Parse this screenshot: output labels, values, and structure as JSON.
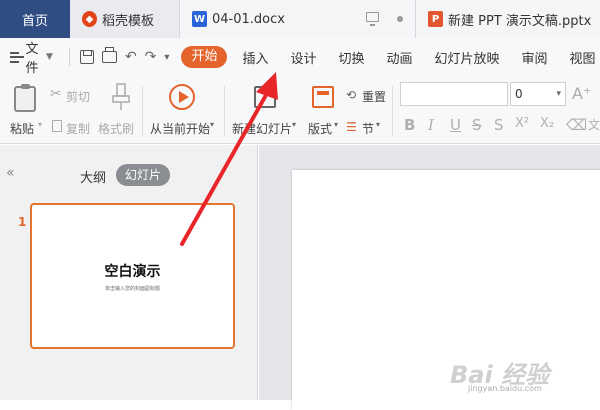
{
  "tabs": [
    {
      "label": "首页",
      "icon": "none",
      "active": true
    },
    {
      "label": "稻壳模板",
      "icon": "template-logo-icon"
    },
    {
      "label": "04-01.docx",
      "icon": "word-doc-icon",
      "icon_letter": "W"
    },
    {
      "label": "新建 PPT 演示文稿.pptx",
      "icon": "ppt-doc-icon",
      "icon_letter": "P"
    }
  ],
  "menubar": {
    "file_label": "文件",
    "items": [
      "开始",
      "插入",
      "设计",
      "切换",
      "动画",
      "幻灯片放映",
      "审阅",
      "视图"
    ],
    "active_item": "开始"
  },
  "ribbon": {
    "paste": "粘贴",
    "cut": "剪切",
    "copy": "复制",
    "format_painter": "格式刷",
    "play_from_current": "从当前开始",
    "new_slide": "新建幻灯片",
    "layout": "版式",
    "reset": "重置",
    "section": "节",
    "font_size": "0"
  },
  "left_pane": {
    "view_outline": "大纲",
    "view_slides": "幻灯片",
    "slide_number": "1",
    "slide_title": "空白演示",
    "slide_subtitle": "单击输入您的封面副标题"
  },
  "watermark": {
    "text": "Bai  经验",
    "url": "jingyan.baidu.com"
  },
  "colors": {
    "accent": "#e4642c",
    "home_tab": "#2f4d82",
    "annotation_arrow": "#e8262a"
  }
}
